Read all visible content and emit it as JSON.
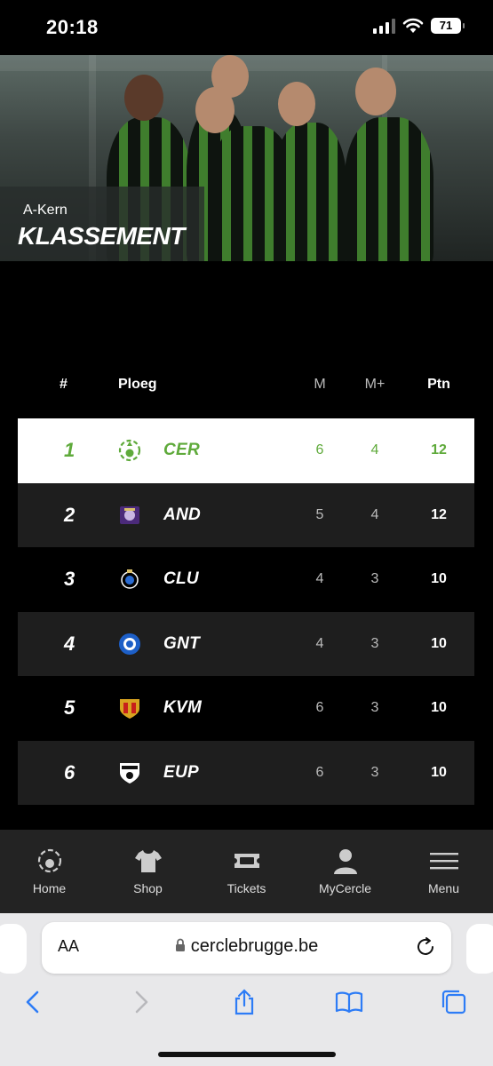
{
  "status_bar": {
    "time": "20:18",
    "battery": "71"
  },
  "hero": {
    "subtitle": "A-Kern",
    "title": "KLASSEMENT"
  },
  "table": {
    "headers": {
      "rank": "#",
      "team": "Ploeg",
      "m": "M",
      "mplus": "M+",
      "pts": "Ptn"
    },
    "rows": [
      {
        "rank": "1",
        "team": "CER",
        "m": "6",
        "mplus": "4",
        "pts": "12",
        "crest": "cercle-brugge-crest-icon"
      },
      {
        "rank": "2",
        "team": "AND",
        "m": "5",
        "mplus": "4",
        "pts": "12",
        "crest": "anderlecht-crest-icon"
      },
      {
        "rank": "3",
        "team": "CLU",
        "m": "4",
        "mplus": "3",
        "pts": "10",
        "crest": "club-brugge-crest-icon"
      },
      {
        "rank": "4",
        "team": "GNT",
        "m": "4",
        "mplus": "3",
        "pts": "10",
        "crest": "gent-crest-icon"
      },
      {
        "rank": "5",
        "team": "KVM",
        "m": "6",
        "mplus": "3",
        "pts": "10",
        "crest": "mechelen-crest-icon"
      },
      {
        "rank": "6",
        "team": "EUP",
        "m": "6",
        "mplus": "3",
        "pts": "10",
        "crest": "eupen-crest-icon"
      }
    ]
  },
  "bottom_nav": [
    {
      "label": "Home",
      "icon": "cercle-logo-icon"
    },
    {
      "label": "Shop",
      "icon": "shirt-icon"
    },
    {
      "label": "Tickets",
      "icon": "ticket-icon"
    },
    {
      "label": "MyCercle",
      "icon": "user-icon"
    },
    {
      "label": "Menu",
      "icon": "hamburger-icon"
    }
  ],
  "browser": {
    "aa_label": "AA",
    "url": "cerclebrugge.be"
  },
  "colors": {
    "accent_green": "#5faa3b",
    "row_dark": "#1e1e1e",
    "nav_bg": "#232323"
  }
}
